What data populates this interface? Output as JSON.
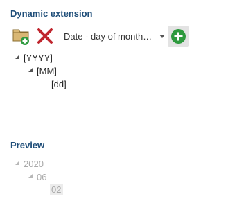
{
  "dynamic_extension": {
    "title": "Dynamic extension",
    "select_value": "Date - day of month…",
    "tree": {
      "level1": "[YYYY]",
      "level2": "[MM]",
      "level3": "[dd]"
    }
  },
  "preview": {
    "title": "Preview",
    "tree": {
      "level1": "2020",
      "level2": "06",
      "level3": "02"
    }
  },
  "icons": {
    "add_folder": "folder-add-icon",
    "remove": "close-x-icon",
    "add": "plus-circle-icon"
  },
  "colors": {
    "title": "#1f4e79",
    "remove_red": "#c0262e",
    "add_green": "#2e9a3e",
    "folder_tan": "#d9b774"
  }
}
